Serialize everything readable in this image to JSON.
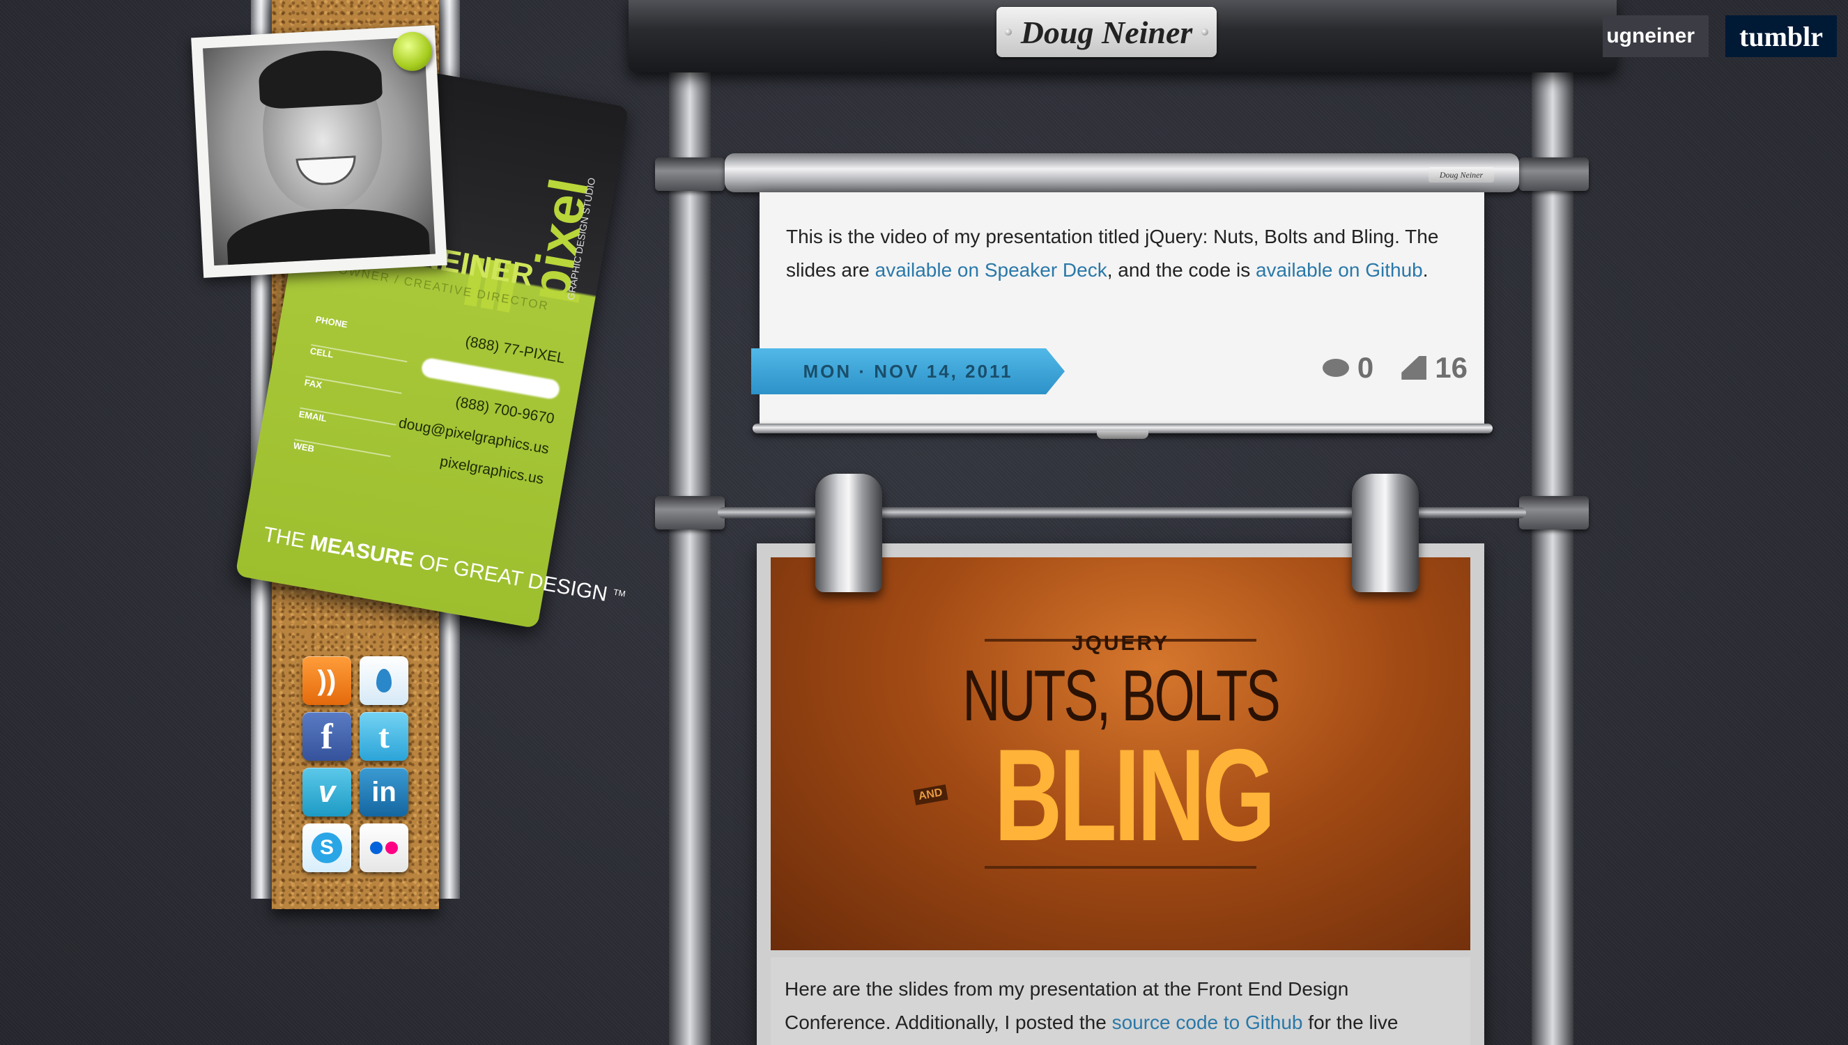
{
  "header": {
    "site_name": "Doug Neiner",
    "username_fragment": "ugneiner",
    "tumblr_label": "tumblr"
  },
  "business_card": {
    "brand": "pixel",
    "brand_sub": "GRAPHIC DESIGN STUDIO",
    "name": "DOUG NEINER",
    "role": "OWNER / CREATIVE DIRECTOR",
    "field_labels": [
      "PHONE",
      "CELL",
      "FAX",
      "EMAIL",
      "WEB"
    ],
    "phone": "(888) 77-PIXEL",
    "fax": "(888) 700-9670",
    "email": "doug@pixelgraphics.us",
    "web": "pixelgraphics.us",
    "tagline_prefix": "THE ",
    "tagline_strong": "MEASURE",
    "tagline_suffix": " OF GREAT DESIGN",
    "tm": "TM"
  },
  "social_icons": [
    "rss-icon",
    "drop-icon",
    "facebook-icon",
    "twitter-icon",
    "vimeo-icon",
    "linkedin-icon",
    "skype-icon",
    "flickr-icon"
  ],
  "post1": {
    "roller_tag": "Doug Neiner",
    "text_a": "This is the video of my presentation titled jQuery: Nuts, Bolts and Bling. The slides are ",
    "link1": "available on Speaker Deck",
    "text_b": ", and the code is ",
    "link2": "available on Github",
    "text_c": ".",
    "date": "MON · NOV 14, 2011",
    "comments": "0",
    "notes": "16"
  },
  "post2": {
    "slide_kicker": "JQUERY",
    "slide_line1": "NUTS, BOLTS",
    "slide_and": "AND",
    "slide_line2": "BLING",
    "caption_a": "Here are the slides from my presentation at the Front End Design Conference. Additionally, I posted the ",
    "caption_link": "source code to Github",
    "caption_b": " for the live"
  },
  "colors": {
    "background": "#2d2f38",
    "link": "#2a78a8",
    "ribbon": "#3aa6dc",
    "card_green": "#a4c535",
    "tumblr_bg": "#001935"
  }
}
